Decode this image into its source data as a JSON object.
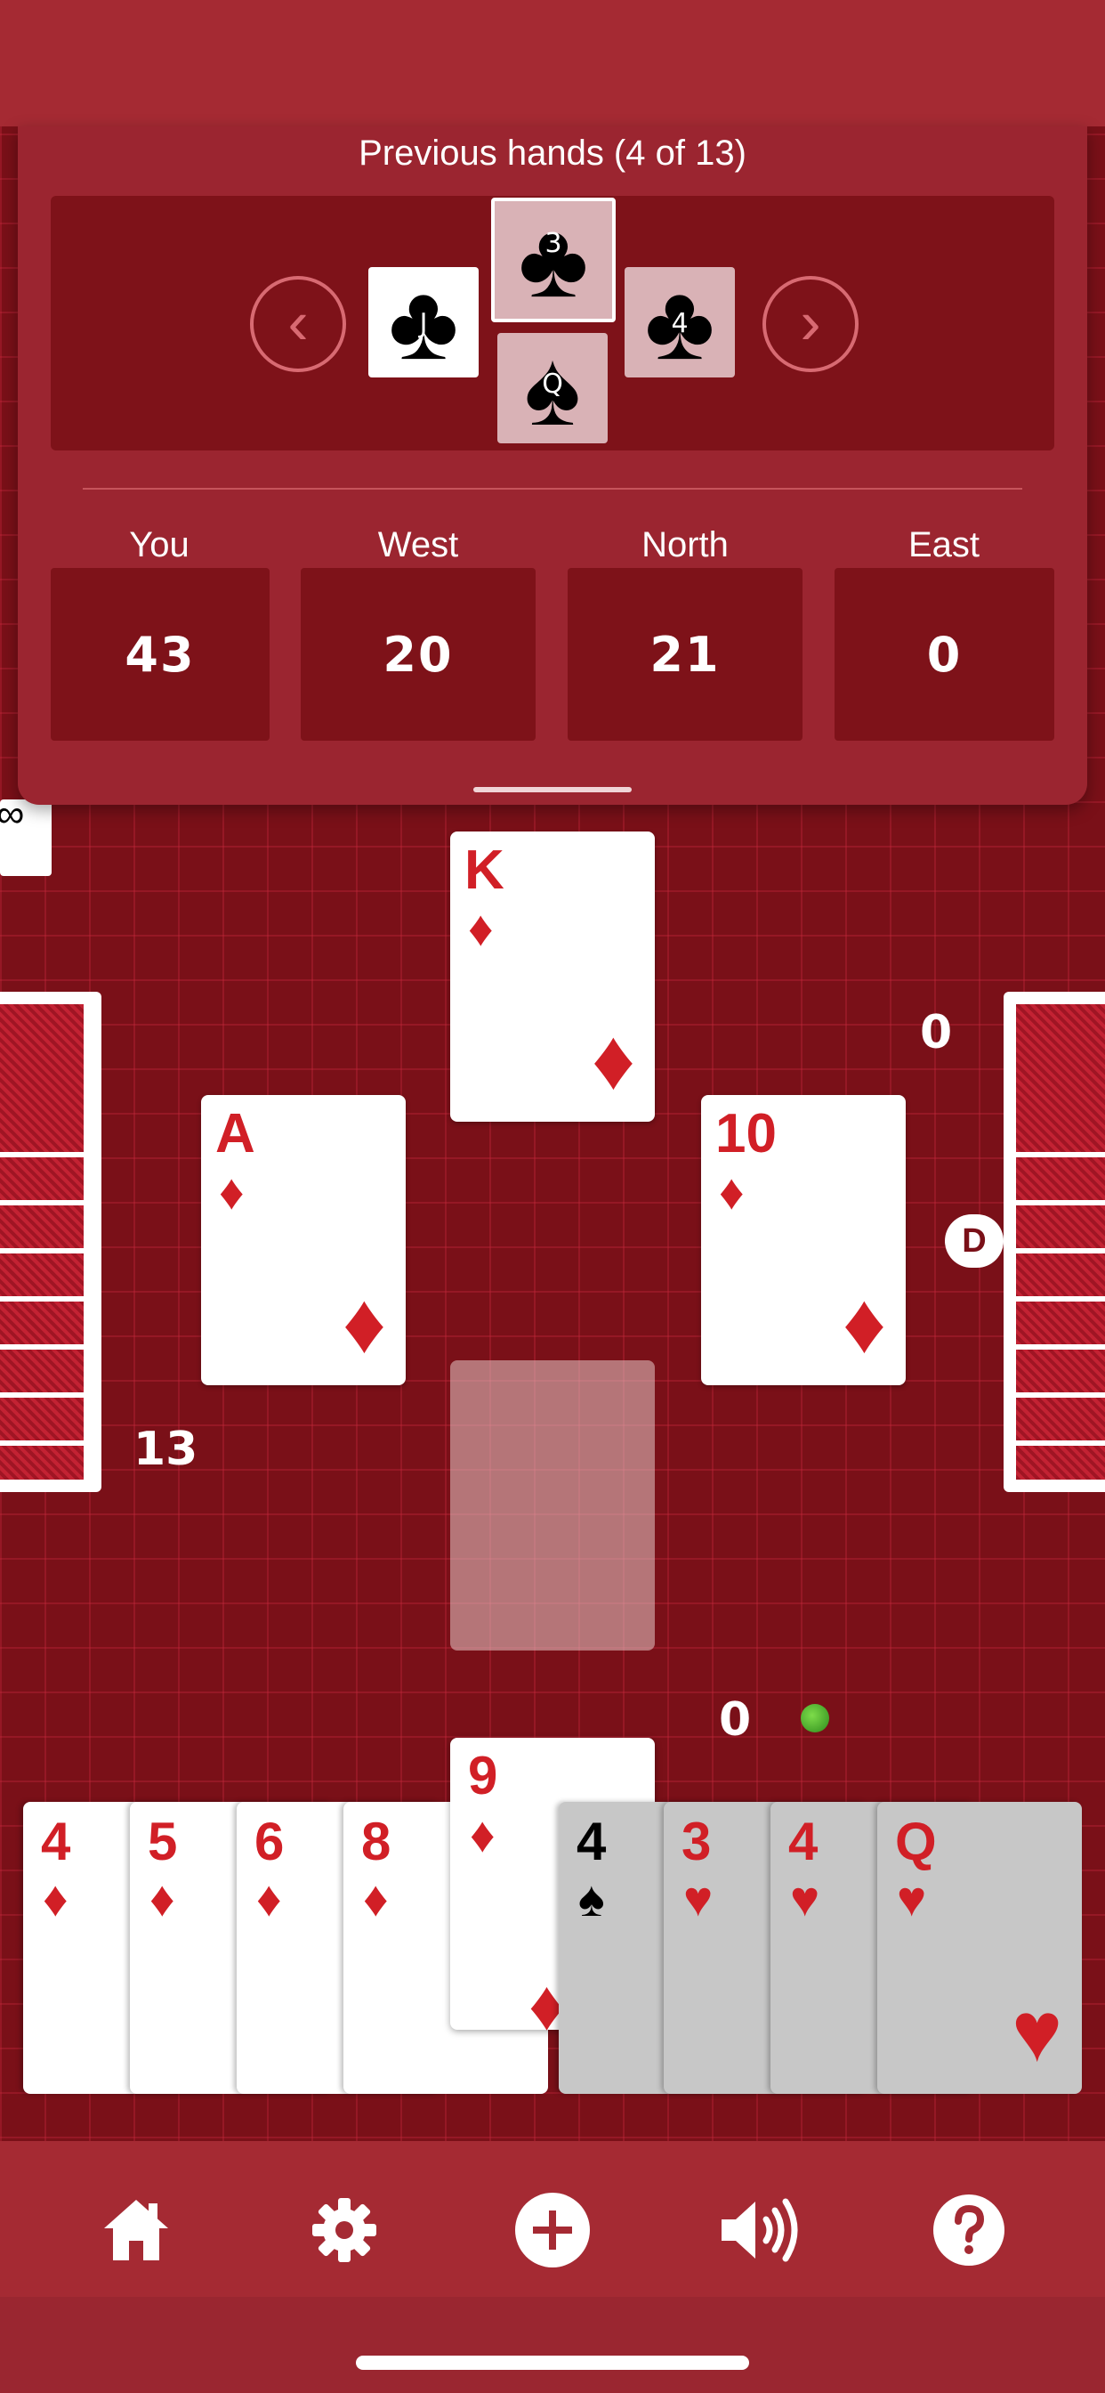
{
  "previous_hands": {
    "title": "Previous hands (4 of 13)",
    "prev_arrow": "‹",
    "next_arrow": "›",
    "cards": {
      "west": {
        "rank": "J",
        "suit": "♣"
      },
      "north": {
        "rank": "3",
        "suit": "♣"
      },
      "east": {
        "rank": "4",
        "suit": "♣"
      },
      "south": {
        "rank": "Q",
        "suit": "♠"
      }
    }
  },
  "scores": [
    {
      "label": "You",
      "value": "43"
    },
    {
      "label": "West",
      "value": "20"
    },
    {
      "label": "North",
      "value": "21"
    },
    {
      "label": "East",
      "value": "0"
    }
  ],
  "trick": {
    "north": {
      "rank": "K",
      "suit": "♦"
    },
    "west": {
      "rank": "A",
      "suit": "♦"
    },
    "east": {
      "rank": "10",
      "suit": "♦"
    }
  },
  "counts": {
    "west": "13",
    "east": "0",
    "south": "0"
  },
  "dealer_badge": "D",
  "west_corner_glyph": "∞",
  "hand": [
    {
      "rank": "4",
      "suit": "♦",
      "color": "red",
      "playable": true
    },
    {
      "rank": "5",
      "suit": "♦",
      "color": "red",
      "playable": true
    },
    {
      "rank": "6",
      "suit": "♦",
      "color": "red",
      "playable": true
    },
    {
      "rank": "8",
      "suit": "♦",
      "color": "red",
      "playable": true
    },
    {
      "rank": "9",
      "suit": "♦",
      "color": "red",
      "playable": true
    },
    {
      "rank": "4",
      "suit": "♠",
      "color": "black",
      "playable": false
    },
    {
      "rank": "3",
      "suit": "♥",
      "color": "red",
      "playable": false
    },
    {
      "rank": "4",
      "suit": "♥",
      "color": "red",
      "playable": false
    },
    {
      "rank": "Q",
      "suit": "♥",
      "color": "red",
      "playable": false
    }
  ],
  "toolbar": [
    {
      "name": "home-icon"
    },
    {
      "name": "gear-icon"
    },
    {
      "name": "add-icon"
    },
    {
      "name": "volume-icon"
    },
    {
      "name": "help-icon"
    }
  ],
  "colors": {
    "table": "#7a1018",
    "bar": "#a52a33",
    "panel": "#9b2530",
    "red_suit": "#d11f26"
  }
}
